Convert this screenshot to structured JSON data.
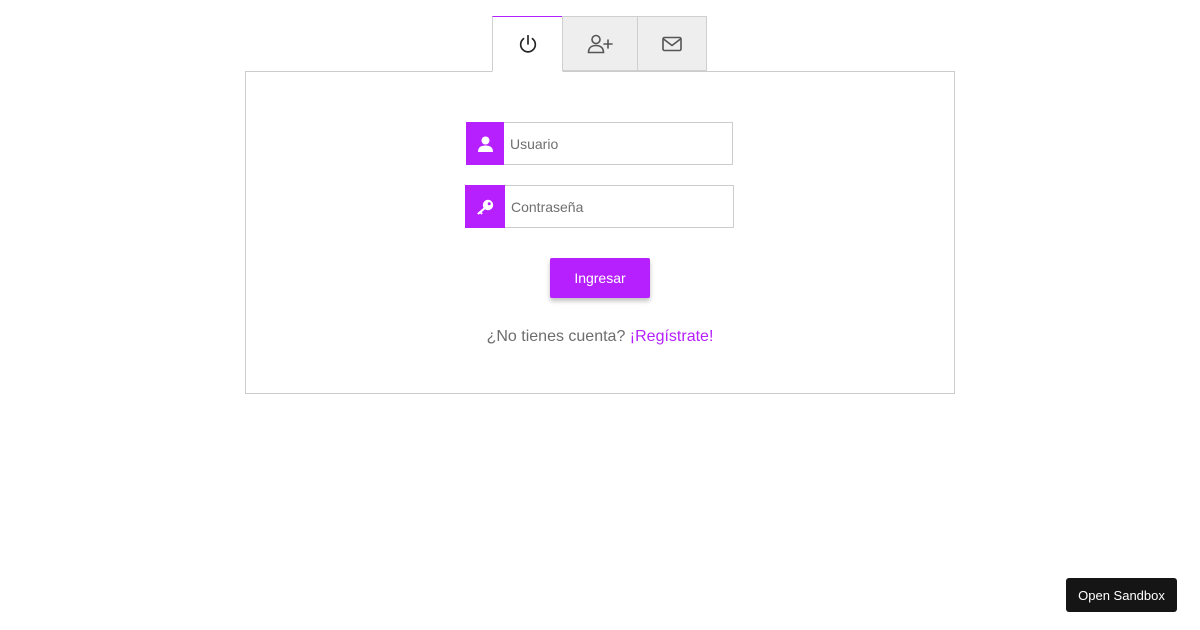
{
  "tabs": [
    {
      "id": "login",
      "icon": "power-icon",
      "active": true
    },
    {
      "id": "register",
      "icon": "user-plus-icon",
      "active": false
    },
    {
      "id": "contact",
      "icon": "envelope-icon",
      "active": false
    }
  ],
  "form": {
    "username": {
      "value": "",
      "placeholder": "Usuario",
      "icon": "user-icon"
    },
    "password": {
      "value": "",
      "placeholder": "Contraseña",
      "icon": "key-icon"
    },
    "submit_label": "Ingresar",
    "signup_prompt": "¿No tienes cuenta?",
    "signup_link": "¡Regístrate!"
  },
  "sandbox": {
    "label": "Open Sandbox"
  },
  "colors": {
    "accent": "#b620ff",
    "tab_inactive": "#eeeeee",
    "border": "#cccccc",
    "sandbox_bg": "#151515"
  }
}
